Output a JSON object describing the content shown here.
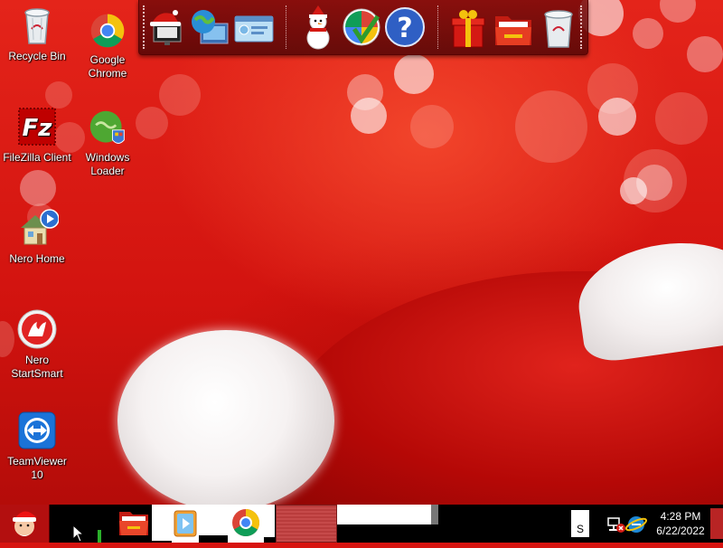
{
  "desktop": {
    "icons": [
      {
        "id": "recycle-bin",
        "label": "Recycle Bin"
      },
      {
        "id": "google-chrome",
        "label": "Google Chrome"
      },
      {
        "id": "filezilla",
        "label": "FileZilla Client"
      },
      {
        "id": "windows-loader",
        "label": "Windows Loader"
      },
      {
        "id": "nero-home",
        "label": "Nero Home"
      },
      {
        "id": "nero-startsmart",
        "label": "Nero StartSmart"
      },
      {
        "id": "teamviewer",
        "label": "TeamViewer 10"
      }
    ]
  },
  "dock": {
    "items": [
      "santa-monitor-icon",
      "network-globe-icon",
      "control-panel-icon",
      "snowman-icon",
      "windows-update-shield-icon",
      "help-icon",
      "gift-icon",
      "folder-icon",
      "recycle-bin-icon"
    ]
  },
  "taskbar": {
    "pinned": [
      "explorer-folder-icon",
      "media-player-icon",
      "chrome-icon"
    ],
    "tray_input_label": "S"
  },
  "clock": {
    "time": "4:28 PM",
    "date": "6/22/2022"
  },
  "colors": {
    "wallpaper_red": "#d81410",
    "taskbar": "#000000"
  }
}
